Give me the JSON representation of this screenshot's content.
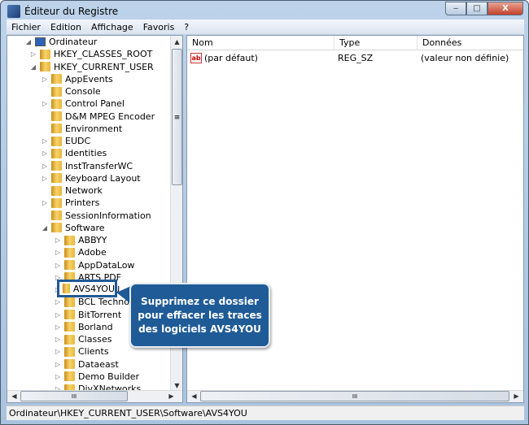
{
  "window": {
    "title": "Éditeur du Registre",
    "minimize": "‒",
    "maximize": "□",
    "close": "X"
  },
  "menu": [
    "Fichier",
    "Edition",
    "Affichage",
    "Favoris",
    "?"
  ],
  "tree": [
    {
      "label": "Ordinateur",
      "level": 0,
      "exp": "◢",
      "icon": "computer"
    },
    {
      "label": "HKEY_CLASSES_ROOT",
      "level": 1,
      "exp": "▷"
    },
    {
      "label": "HKEY_CURRENT_USER",
      "level": 1,
      "exp": "◢"
    },
    {
      "label": "AppEvents",
      "level": 2,
      "exp": "▷"
    },
    {
      "label": "Console",
      "level": 2,
      "exp": ""
    },
    {
      "label": "Control Panel",
      "level": 2,
      "exp": "▷"
    },
    {
      "label": "D&M MPEG Encoder",
      "level": 2,
      "exp": ""
    },
    {
      "label": "Environment",
      "level": 2,
      "exp": ""
    },
    {
      "label": "EUDC",
      "level": 2,
      "exp": "▷"
    },
    {
      "label": "Identities",
      "level": 2,
      "exp": "▷"
    },
    {
      "label": "InstTransferWC",
      "level": 2,
      "exp": "▷"
    },
    {
      "label": "Keyboard Layout",
      "level": 2,
      "exp": "▷"
    },
    {
      "label": "Network",
      "level": 2,
      "exp": ""
    },
    {
      "label": "Printers",
      "level": 2,
      "exp": "▷"
    },
    {
      "label": "SessionInformation",
      "level": 2,
      "exp": ""
    },
    {
      "label": "Software",
      "level": 2,
      "exp": "◢"
    },
    {
      "label": "ABBYY",
      "level": 3,
      "exp": "▷"
    },
    {
      "label": "Adobe",
      "level": 3,
      "exp": "▷"
    },
    {
      "label": "AppDataLow",
      "level": 3,
      "exp": "▷"
    },
    {
      "label": "ARTS PDF",
      "level": 3,
      "exp": "▷"
    },
    {
      "label": "AVS4YOU",
      "level": 3,
      "exp": "▷",
      "selected": true
    },
    {
      "label": "BCL Technologies",
      "level": 3,
      "exp": "▷"
    },
    {
      "label": "BitTorrent",
      "level": 3,
      "exp": "▷"
    },
    {
      "label": "Borland",
      "level": 3,
      "exp": "▷"
    },
    {
      "label": "Classes",
      "level": 3,
      "exp": "▷"
    },
    {
      "label": "Clients",
      "level": 3,
      "exp": "▷"
    },
    {
      "label": "Dataeast",
      "level": 3,
      "exp": "▷"
    },
    {
      "label": "Demo Builder",
      "level": 3,
      "exp": "▷"
    },
    {
      "label": "DivXNetworks",
      "level": 3,
      "exp": "▷"
    }
  ],
  "columns": {
    "name": "Nom",
    "type": "Type",
    "data": "Données"
  },
  "values": [
    {
      "name": "(par défaut)",
      "type": "REG_SZ",
      "data": "(valeur non définie)",
      "icon": "ab"
    }
  ],
  "scroll": {
    "grip": "≡",
    "hgrip": "III"
  },
  "status": "Ordinateur\\HKEY_CURRENT_USER\\Software\\AVS4YOU",
  "callout": "Supprimez ce dossier pour effacer les traces des logiciels AVS4YOU"
}
